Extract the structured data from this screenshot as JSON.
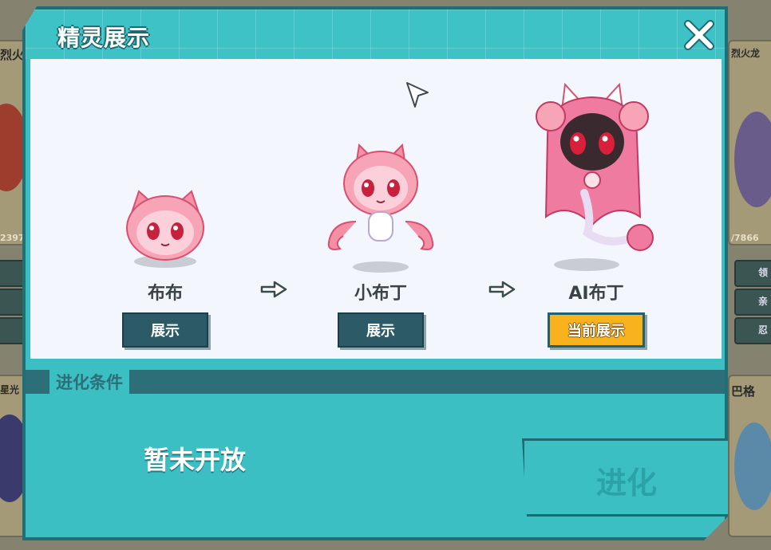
{
  "background": {
    "left_labels": [
      "烈火",
      "2397",
      "星光"
    ],
    "right_labels": [
      "烈火龙",
      "/7866",
      "领",
      "亲",
      "忍",
      "巴格"
    ]
  },
  "modal": {
    "title": "精灵展示",
    "close_icon": "close-x-icon"
  },
  "evolution": {
    "stages": [
      {
        "name": "布布",
        "button": "展示",
        "active": false,
        "body_color": "#f48fa5"
      },
      {
        "name": "小布丁",
        "button": "展示",
        "active": false,
        "body_color": "#f48fa5"
      },
      {
        "name": "AI布丁",
        "button": "当前展示",
        "active": true,
        "body_color": "#f07ba0"
      }
    ],
    "arrow_icon": "evolve-arrow-icon"
  },
  "conditions": {
    "tab_label": "进化条件",
    "status_text": "暂未开放"
  },
  "evolve_button": {
    "label": "进化"
  },
  "colors": {
    "panel": "#3bbfc2",
    "border": "#1e6f76",
    "stage_bg": "#f3f6fc",
    "button_dark": "#2c5a67",
    "button_active": "#f7b21e"
  }
}
